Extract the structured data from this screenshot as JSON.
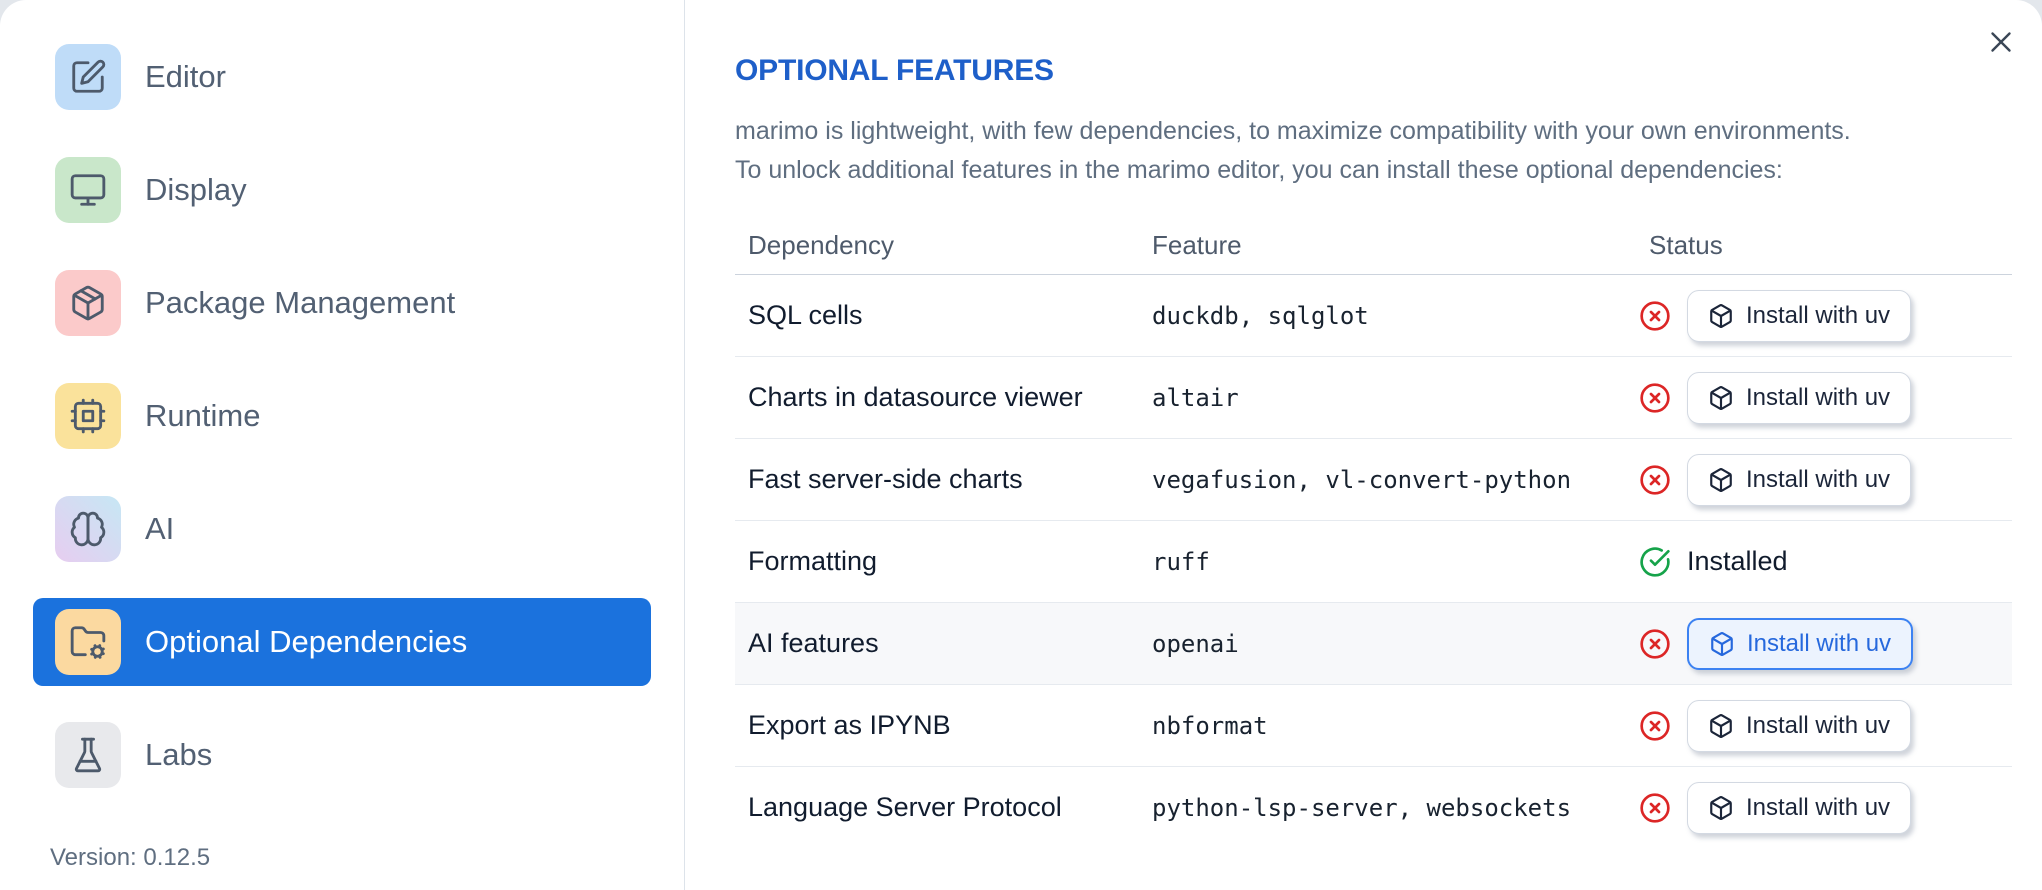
{
  "sidebar": {
    "items": [
      {
        "label": "Editor",
        "icon": "square-pen"
      },
      {
        "label": "Display",
        "icon": "monitor"
      },
      {
        "label": "Package Management",
        "icon": "package"
      },
      {
        "label": "Runtime",
        "icon": "cpu"
      },
      {
        "label": "AI",
        "icon": "brain"
      },
      {
        "label": "Optional Dependencies",
        "icon": "folder-cog",
        "selected": true
      },
      {
        "label": "Labs",
        "icon": "flask"
      }
    ],
    "version": "Version: 0.12.5"
  },
  "main": {
    "title": "OPTIONAL FEATURES",
    "description_line1": "marimo is lightweight, with few dependencies, to maximize compatibility with your own environments.",
    "description_line2": "To unlock additional features in the marimo editor, you can install these optional dependencies:",
    "table": {
      "headers": {
        "dependency": "Dependency",
        "feature": "Feature",
        "status": "Status"
      },
      "install_button_label": "Install with uv",
      "installed_label": "Installed",
      "rows": [
        {
          "dependency": "SQL cells",
          "feature": "duckdb, sqlglot",
          "status": "not-installed"
        },
        {
          "dependency": "Charts in datasource viewer",
          "feature": "altair",
          "status": "not-installed"
        },
        {
          "dependency": "Fast server-side charts",
          "feature": "vegafusion, vl-convert-python",
          "status": "not-installed"
        },
        {
          "dependency": "Formatting",
          "feature": "ruff",
          "status": "installed"
        },
        {
          "dependency": "AI features",
          "feature": "openai",
          "status": "not-installed",
          "highlighted": true
        },
        {
          "dependency": "Export as IPYNB",
          "feature": "nbformat",
          "status": "not-installed"
        },
        {
          "dependency": "Language Server Protocol",
          "feature": "python-lsp-server, websockets",
          "status": "not-installed"
        }
      ]
    }
  },
  "colors": {
    "accent_blue": "#1b72dd",
    "title_blue": "#1e5fc9",
    "error_red": "#dc2626",
    "success_green": "#16a34a",
    "focus_button_blue": "#2668dd"
  }
}
